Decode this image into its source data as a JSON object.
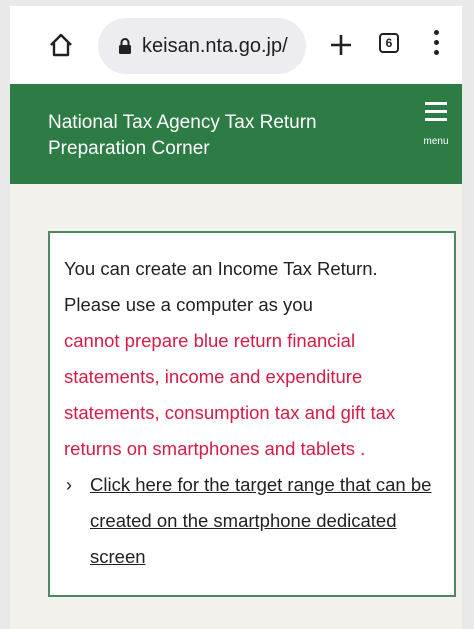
{
  "browser": {
    "url": "keisan.nta.go.jp/",
    "tab_count": "6",
    "icons": {
      "home": "home-icon",
      "lock": "lock-icon",
      "new_tab": "plus-icon",
      "tabs": "tab-switcher-icon",
      "more": "more-vertical-icon"
    }
  },
  "header": {
    "title": "National Tax Agency Tax Return Preparation Corner",
    "menu_label": "menu",
    "background_color": "#2d7c45"
  },
  "notice": {
    "line1": "You can create an Income Tax Return.",
    "line2": "Please use a computer as you",
    "warning": "cannot prepare blue return financial statements, income and expenditure statements, consumption tax and gift tax returns on smartphones and tablets .",
    "link_text": "Click here for the target range that can be created on the smartphone dedicated screen",
    "warning_color": "#d81b45"
  }
}
